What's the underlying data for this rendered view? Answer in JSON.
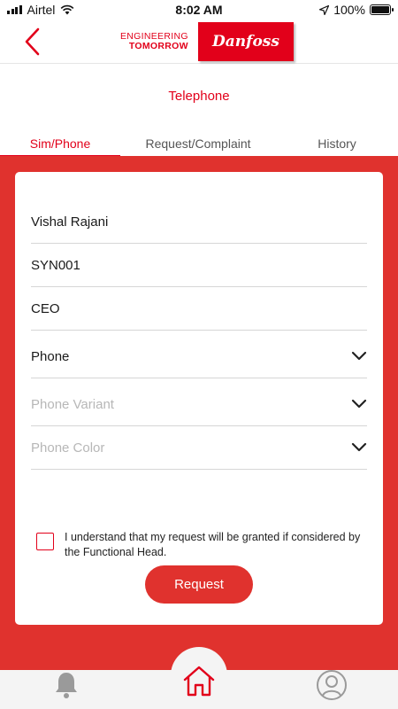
{
  "status_bar": {
    "carrier": "Airtel",
    "time": "8:02 AM",
    "battery": "100%",
    "battery_level": 1.0
  },
  "header": {
    "tagline_line1": "ENGINEERING",
    "tagline_line2": "TOMORROW",
    "logo_text": "Danfoss",
    "accent_color": "#e2001a"
  },
  "page": {
    "title": "Telephone"
  },
  "tabs": [
    {
      "label": "Sim/Phone",
      "active": true
    },
    {
      "label": "Request/Complaint",
      "active": false
    },
    {
      "label": "History",
      "active": false
    }
  ],
  "form": {
    "name": "Vishal Rajani",
    "employee_id": "SYN001",
    "designation": "CEO",
    "device_type": "Phone",
    "phone_variant_placeholder": "Phone Variant",
    "phone_color_placeholder": "Phone Color",
    "agreement_text": "I understand that my request will be granted if considered by the Functional Head.",
    "agreement_checked": false,
    "request_button": "Request"
  },
  "bottom_nav": {
    "icons": [
      "bell-icon",
      "home-icon",
      "profile-icon"
    ],
    "active": "home-icon"
  }
}
